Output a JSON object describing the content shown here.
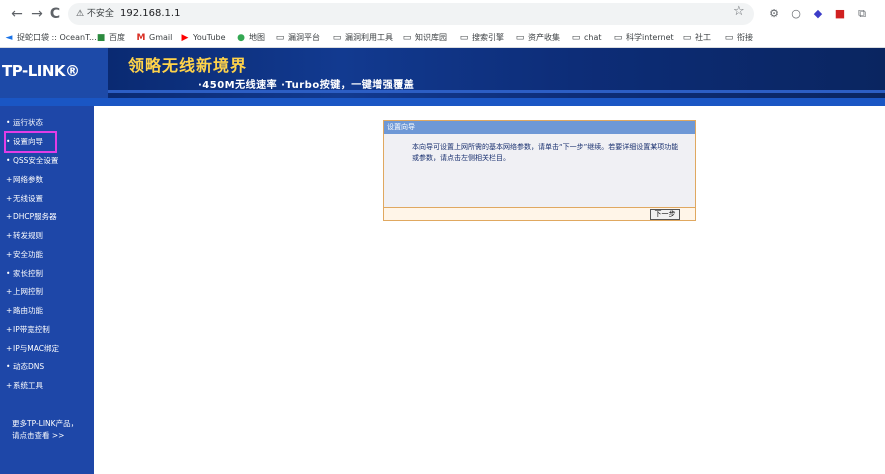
{
  "browser": {
    "back": "←",
    "forward": "→",
    "reload": "C",
    "insecure_label": "⚠ 不安全",
    "url": "192.168.1.1",
    "star": "☆"
  },
  "bookmarks": [
    {
      "label": "捉蛇口袋 :: OceanT...",
      "icon": "◄"
    },
    {
      "label": "百度",
      "icon": "■"
    },
    {
      "label": "Gmail",
      "icon": "M"
    },
    {
      "label": "YouTube",
      "icon": "▶"
    },
    {
      "label": "地图",
      "icon": "●"
    },
    {
      "label": "漏洞平台",
      "icon": "▭"
    },
    {
      "label": "漏洞利用工具",
      "icon": "▭"
    },
    {
      "label": "知识库园",
      "icon": "▭"
    },
    {
      "label": "搜索引擎",
      "icon": "▭"
    },
    {
      "label": "资产收集",
      "icon": "▭"
    },
    {
      "label": "chat",
      "icon": "▭"
    },
    {
      "label": "科学internet",
      "icon": "▭"
    },
    {
      "label": "社工",
      "icon": "▭"
    },
    {
      "label": "衔接",
      "icon": "▭"
    }
  ],
  "header": {
    "logo": "TP-LINK®",
    "title": "领略无线新境界",
    "subtitle": "·450M无线速率   ·Turbo按键，一键增强覆盖"
  },
  "sidebar": {
    "items": [
      "运行状态",
      "设置向导",
      "QSS安全设置",
      "网络参数",
      "无线设置",
      "DHCP服务器",
      "转发规则",
      "安全功能",
      "家长控制",
      "上网控制",
      "路由功能",
      "IP带宽控制",
      "IP与MAC绑定",
      "动态DNS",
      "系统工具"
    ],
    "more_line1": "更多TP-LINK产品，",
    "more_line2": "请点击查看 >>"
  },
  "wizard": {
    "title": "设置向导",
    "text": "本向导可设置上网所需的基本网络参数，请单击“下一步”继续。若要详细设置某项功能或参数，请点击左侧相关栏目。",
    "next_label": "下一步"
  }
}
